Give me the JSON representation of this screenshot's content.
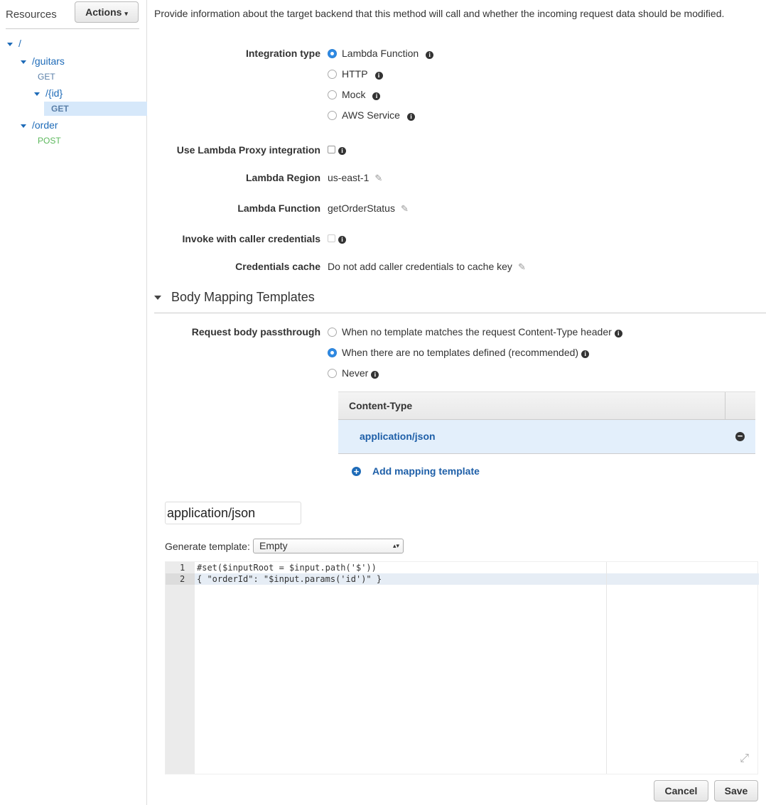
{
  "sidebar": {
    "title": "Resources",
    "actions": "Actions",
    "tree": [
      {
        "label": "/"
      },
      {
        "label": "/guitars"
      },
      {
        "label": "GET"
      },
      {
        "label": "/{id}"
      },
      {
        "label": "GET"
      },
      {
        "label": "/order"
      },
      {
        "label": "POST"
      }
    ]
  },
  "main": {
    "intro": "Provide information about the target backend that this method will call and whether the incoming request data should be modified.",
    "integration_type": {
      "label": "Integration type",
      "options": [
        "Lambda Function",
        "HTTP",
        "Mock",
        "AWS Service"
      ],
      "selected": "Lambda Function"
    },
    "proxy": {
      "label": "Use Lambda Proxy integration",
      "checked": false
    },
    "region": {
      "label": "Lambda Region",
      "value": "us-east-1"
    },
    "function": {
      "label": "Lambda Function",
      "value": "getOrderStatus"
    },
    "caller_creds": {
      "label": "Invoke with caller credentials",
      "checked": false
    },
    "creds_cache": {
      "label": "Credentials cache",
      "value": "Do not add caller credentials to cache key"
    },
    "body_mapping": {
      "title": "Body Mapping Templates",
      "passthrough": {
        "label": "Request body passthrough",
        "options": [
          "When no template matches the request Content-Type header",
          "When there are no templates defined (recommended)",
          "Never"
        ],
        "selected": "When there are no templates defined (recommended)"
      },
      "table": {
        "header": "Content-Type",
        "rows": [
          "application/json"
        ]
      },
      "add": "Add mapping template",
      "content_type_input": "application/json",
      "generate_label": "Generate template:",
      "generate_value": "Empty",
      "code": [
        "#set($inputRoot = $input.path('$'))",
        "{ \"orderId\": \"$input.params('id')\" }"
      ]
    },
    "cancel": "Cancel",
    "save": "Save"
  },
  "colors": {
    "accent": "#1e6bb8",
    "post": "#5cb85c",
    "selected": "#d6e8fa"
  }
}
